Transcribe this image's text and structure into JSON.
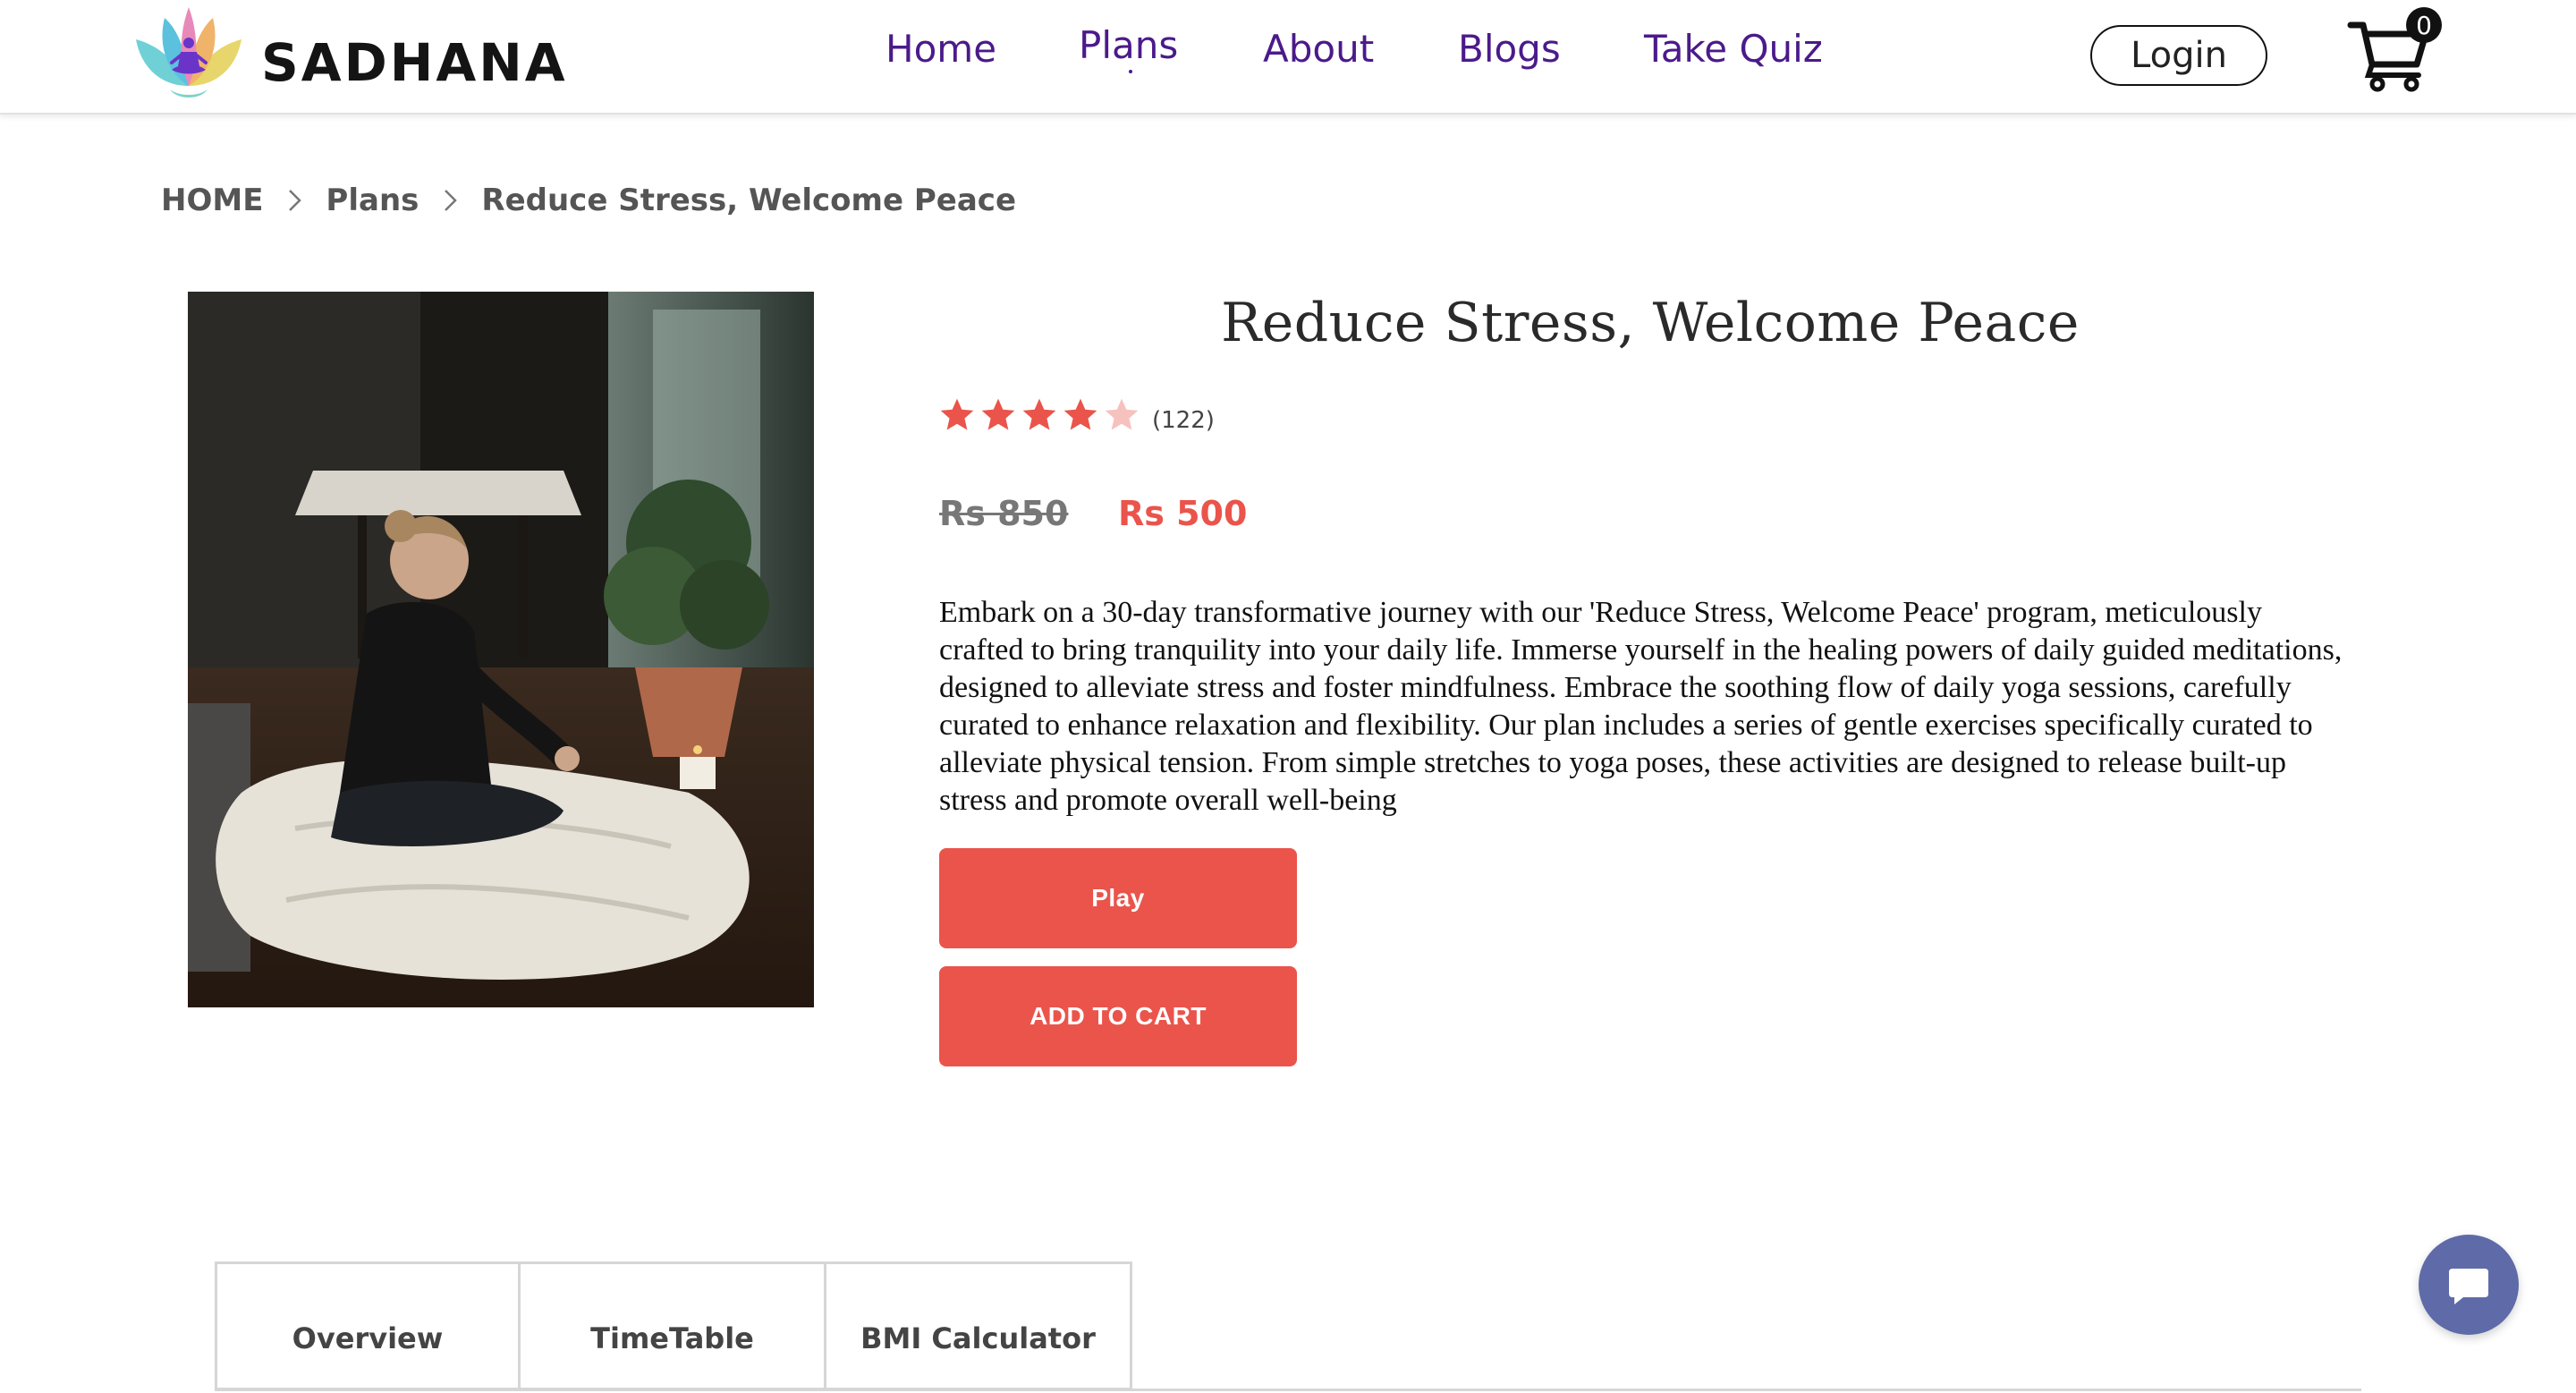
{
  "header": {
    "brand": "SADHANA",
    "logo_icon": "lotus-meditation-icon",
    "nav": {
      "home": "Home",
      "plans": "Plans",
      "about": "About",
      "blogs": "Blogs",
      "quiz": "Take Quiz"
    },
    "login_label": "Login",
    "cart_icon": "cart-icon",
    "cart_count": "0"
  },
  "breadcrumb": {
    "home": "HOME",
    "plans": "Plans",
    "current": "Reduce Stress, Welcome Peace"
  },
  "product": {
    "title": "Reduce Stress, Welcome Peace",
    "rating": 4,
    "rating_max": 5,
    "rating_count": "(122)",
    "price_old": "Rs 850",
    "price_new": "Rs 500",
    "description": "Embark on a 30-day transformative journey with our 'Reduce Stress, Welcome Peace' program, meticulously crafted to bring tranquility into your daily life. Immerse yourself in the healing powers of daily guided meditations, designed to alleviate stress and foster mindfulness. Embrace the soothing flow of daily yoga sessions, carefully curated to enhance relaxation and flexibility. Our plan includes a series of gentle exercises specifically curated to alleviate physical tension. From simple stretches to yoga poses, these activities are designed to release built-up stress and promote overall well-being",
    "play_label": "Play",
    "add_to_cart_label": "ADD TO CART"
  },
  "tabs": {
    "overview": "Overview",
    "timetable": "TimeTable",
    "bmi": "BMI Calculator"
  },
  "chat_icon": "chat-bubble-icon",
  "colors": {
    "accent": "#ea544b",
    "nav": "#4b1a8a",
    "chat": "#5f6ba8"
  }
}
